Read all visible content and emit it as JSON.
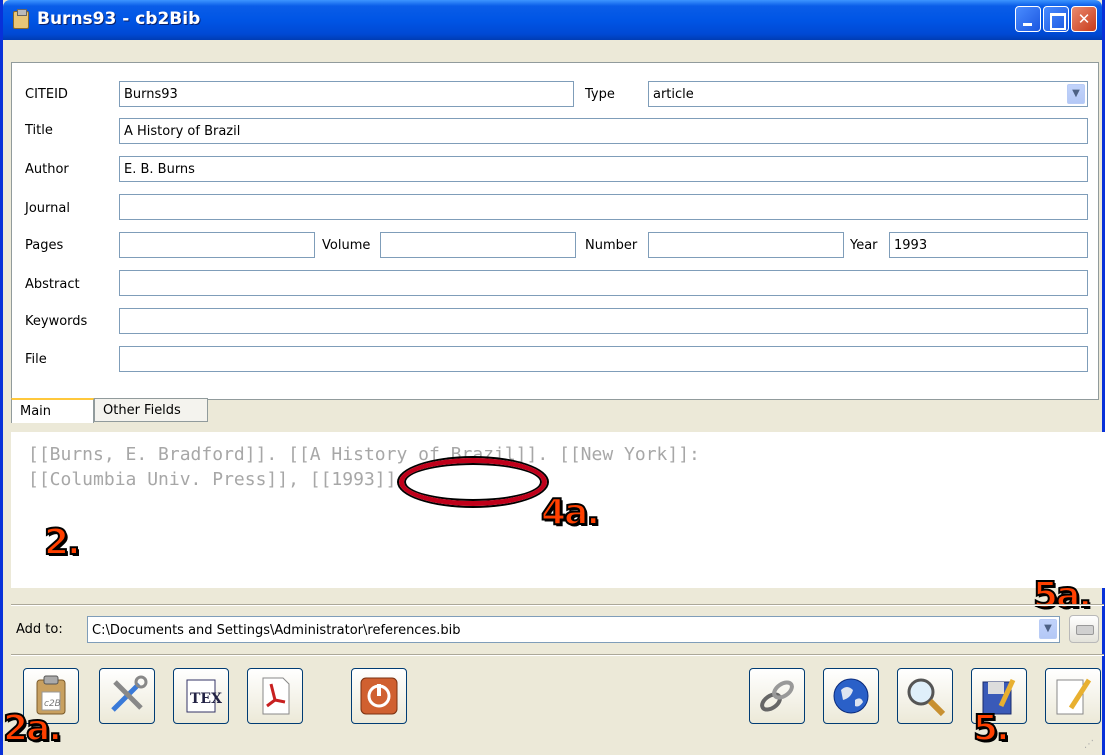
{
  "window": {
    "title": "Burns93 - cb2Bib"
  },
  "form": {
    "citeid_label": "CITEID",
    "citeid_value": "Burns93",
    "type_label": "Type",
    "type_value": "article",
    "title_label": "Title",
    "title_value": "A History of Brazil",
    "author_label": "Author",
    "author_value": "E. B. Burns",
    "journal_label": "Journal",
    "journal_value": "",
    "pages_label": "Pages",
    "pages_value": "",
    "volume_label": "Volume",
    "volume_value": "",
    "number_label": "Number",
    "number_value": "",
    "year_label": "Year",
    "year_value": "1993",
    "abstract_label": "Abstract",
    "abstract_value": "",
    "keywords_label": "Keywords",
    "keywords_value": "",
    "file_label": "File",
    "file_value": ""
  },
  "tabs": {
    "main": "Main",
    "other": "Other Fields"
  },
  "preview": {
    "line1": "[[Burns, E. Bradford]]. [[A History of Brazil]]. [[New York]]:",
    "line2": "[[Columbia Univ. Press]], [[1993]]."
  },
  "annotations": {
    "a2": "2.",
    "a2a": "2a.",
    "a4a": "4a.",
    "a5": "5.",
    "a5a": "5a."
  },
  "addto": {
    "label": "Add to:",
    "value": "C:\\Documents and Settings\\Administrator\\references.bib"
  },
  "icons": {
    "left": [
      "clipboard-c2b-icon",
      "tools-icon",
      "tex-icon",
      "pdf-icon",
      "power-icon"
    ],
    "right": [
      "link-icon",
      "globe-icon",
      "search-icon",
      "save-icon",
      "edit-icon"
    ]
  },
  "colors": {
    "annotation": "#ff4000",
    "title_bar": "#0055e5",
    "ellipse": "#c0001a"
  }
}
